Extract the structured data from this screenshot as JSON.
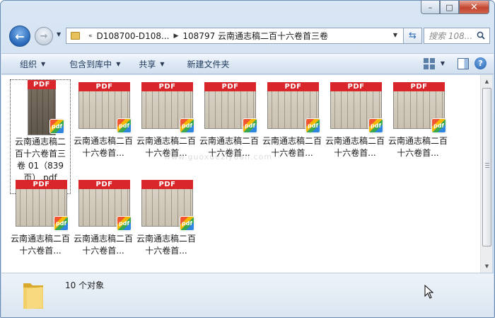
{
  "window": {
    "caption_buttons": {
      "minimize": "–",
      "maximize": "□",
      "close": "✕"
    }
  },
  "nav": {
    "address_segments": [
      "D108700-D108...",
      "108797 云南通志稿二百十六卷首三卷"
    ],
    "overflow_chevron": "«",
    "search_placeholder": "搜索 108..."
  },
  "toolbar": {
    "organize": "组织",
    "include_library": "包含到库中",
    "share": "共享",
    "new_folder": "新建文件夹"
  },
  "files": [
    {
      "label": "云南通志稿二百十六卷首三卷 01（839页）.pdf",
      "selected": true,
      "thumb": "tall"
    },
    {
      "label": "云南通志稿二百十六卷首...",
      "selected": false,
      "thumb": "wide"
    },
    {
      "label": "云南通志稿二百十六卷首...",
      "selected": false,
      "thumb": "wide"
    },
    {
      "label": "云南通志稿二百十六卷首...",
      "selected": false,
      "thumb": "wide"
    },
    {
      "label": "云南通志稿二百十六卷首...",
      "selected": false,
      "thumb": "wide"
    },
    {
      "label": "云南通志稿二百十六卷首...",
      "selected": false,
      "thumb": "wide"
    },
    {
      "label": "云南通志稿二百十六卷首...",
      "selected": false,
      "thumb": "wide"
    },
    {
      "label": "云南通志稿二百十六卷首...",
      "selected": false,
      "thumb": "wide"
    },
    {
      "label": "云南通志稿二百十六卷首...",
      "selected": false,
      "thumb": "wide"
    },
    {
      "label": "云南通志稿二百十六卷首...",
      "selected": false,
      "thumb": "wide"
    }
  ],
  "thumb_band": "PDF",
  "badge": "pdf",
  "watermark": "www.guoxueziyuan.com",
  "status": {
    "count": "10 个对象"
  }
}
